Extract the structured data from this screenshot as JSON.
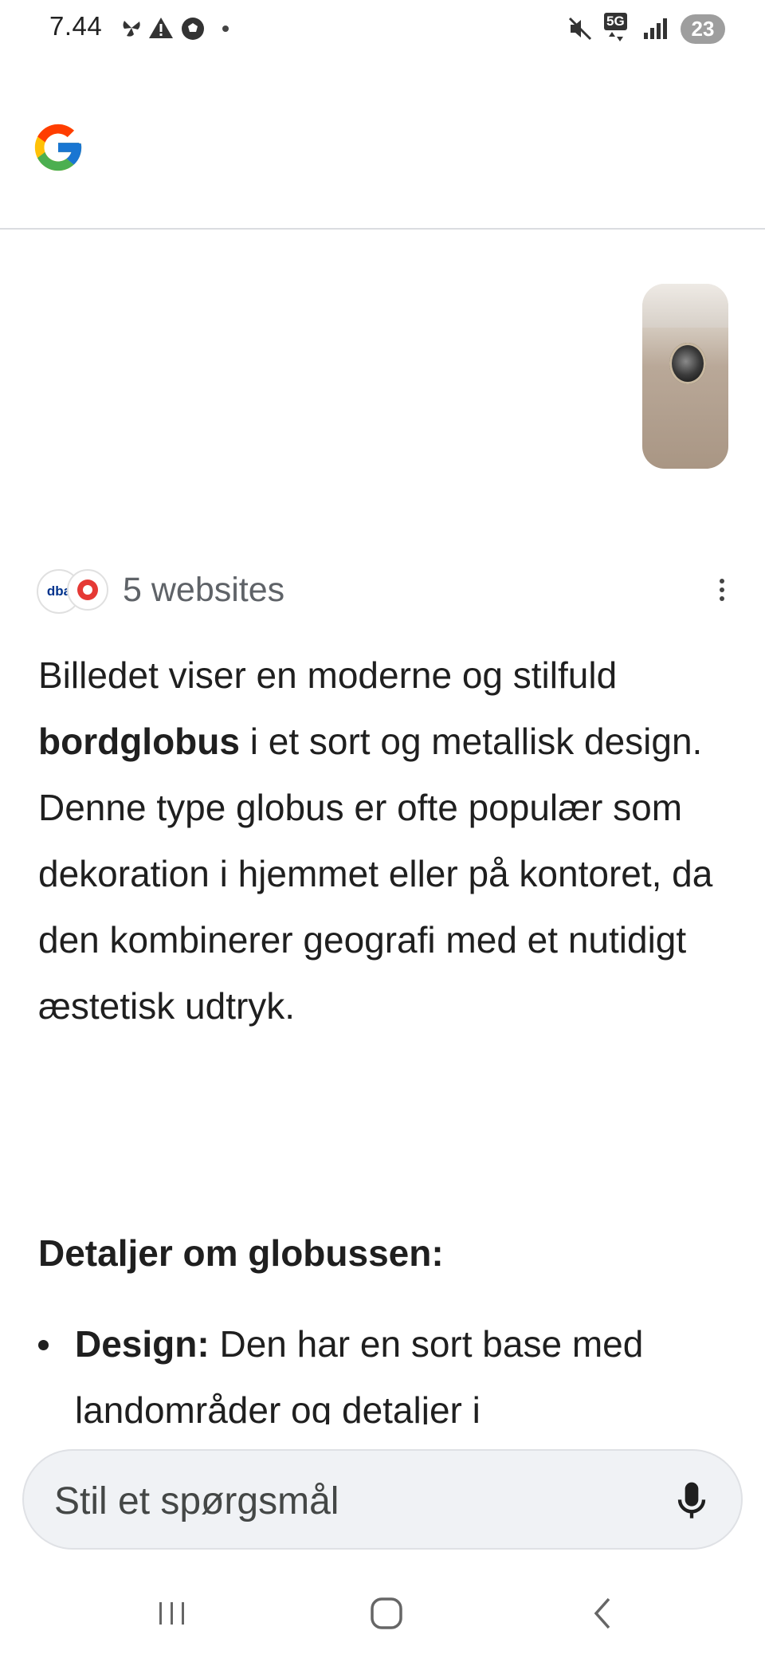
{
  "status_bar": {
    "time": "7.44",
    "network": "5G",
    "battery": "23"
  },
  "header": {
    "logo": "google-g-logo"
  },
  "sources": {
    "label": "5 websites",
    "logo_1": "dba"
  },
  "answer": {
    "p1_before": "Billedet viser en moderne og stilfuld ",
    "p1_bold": "bordglobus",
    "p1_after": " i et sort og metallisk design. Denne type globus er ofte populær som dekoration i hjemmet eller på kontoret, da den kombinerer geografi med et nutidigt æstetisk udtryk."
  },
  "details": {
    "heading": "Detaljer om globussen:",
    "items": [
      {
        "term": "Design:",
        "text": " Den har en sort base med landområder og detaljer i"
      }
    ]
  },
  "ask": {
    "placeholder": "Stil et spørgsmål"
  },
  "colors": {
    "background": "#ffffff",
    "ask_bar": "#f0f2f5",
    "secondary_text": "#5f6368"
  }
}
